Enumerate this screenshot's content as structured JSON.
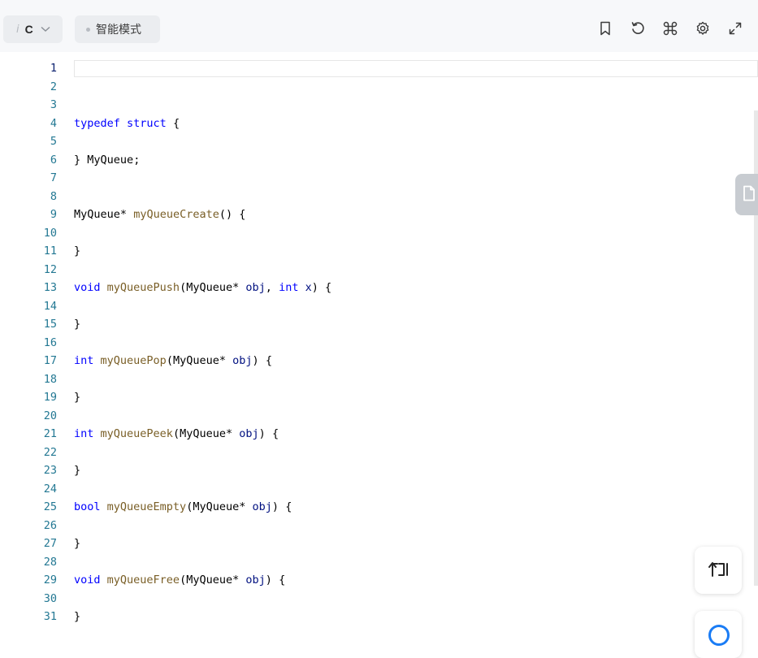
{
  "toolbar": {
    "language": {
      "tag": "i",
      "name": "C",
      "icon": "chevron-down-icon"
    },
    "mode_label": "智能模式",
    "icons": [
      "bookmark-icon",
      "reset-icon",
      "command-icon",
      "settings-icon",
      "expand-icon"
    ]
  },
  "editor": {
    "active_line": 1,
    "lines": [
      "",
      "",
      "",
      "typedef struct {",
      "",
      "} MyQueue;",
      "",
      "",
      "MyQueue* myQueueCreate() {",
      "",
      "}",
      "",
      "void myQueuePush(MyQueue* obj, int x) {",
      "",
      "}",
      "",
      "int myQueuePop(MyQueue* obj) {",
      "",
      "}",
      "",
      "int myQueuePeek(MyQueue* obj) {",
      "",
      "}",
      "",
      "bool myQueueEmpty(MyQueue* obj) {",
      "",
      "}",
      "",
      "void myQueueFree(MyQueue* obj) {",
      "",
      "}"
    ]
  },
  "colors": {
    "keyword": "#0000ff",
    "function": "#795e26",
    "param": "#001080",
    "text": "#000000",
    "line_number": "#237893",
    "active_line_number": "#0b216f",
    "accent": "#1a7cf5"
  },
  "side": {
    "tab_icon": "file-icon",
    "float_icon": "restore-icon"
  }
}
